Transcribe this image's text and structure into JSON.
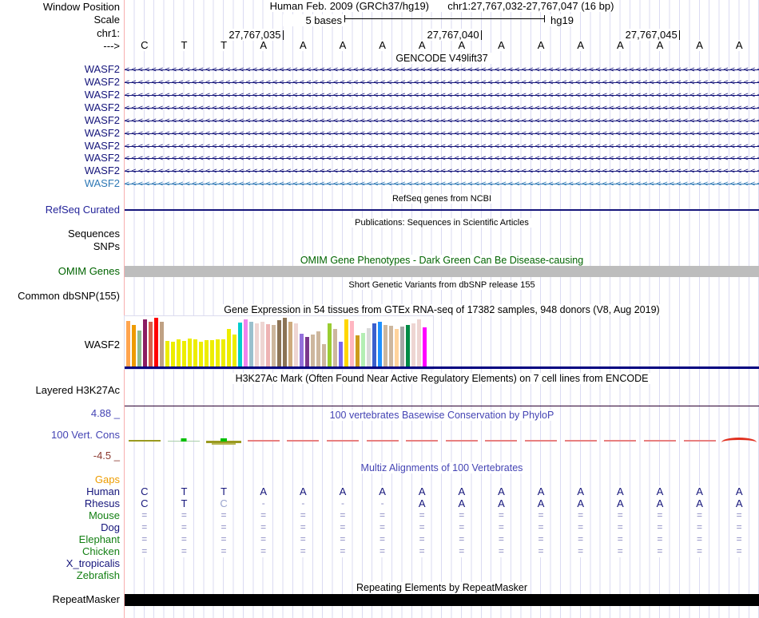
{
  "header": {
    "window_position_label": "Window Position",
    "assembly_title": "Human Feb. 2009 (GRCh37/hg19)",
    "position_title": "chr1:27,767,032-27,767,047 (16 bp)",
    "scale_label": "Scale",
    "scale_value": "5 bases",
    "assembly_tag": "hg19",
    "chrom_label": "chr1:",
    "strand_label": "--->",
    "ruler_positions": [
      "27,767,035",
      "27,767,040",
      "27,767,045"
    ]
  },
  "sequence": {
    "bases": [
      "C",
      "T",
      "T",
      "A",
      "A",
      "A",
      "A",
      "A",
      "A",
      "A",
      "A",
      "A",
      "A",
      "A",
      "A",
      "A"
    ]
  },
  "gencode": {
    "title": "GENCODE V49lift37",
    "genes": [
      {
        "label": "WASF2",
        "color": "#15157B"
      },
      {
        "label": "WASF2",
        "color": "#15157B"
      },
      {
        "label": "WASF2",
        "color": "#15157B"
      },
      {
        "label": "WASF2",
        "color": "#15157B"
      },
      {
        "label": "WASF2",
        "color": "#15157B"
      },
      {
        "label": "WASF2",
        "color": "#15157B"
      },
      {
        "label": "WASF2",
        "color": "#15157B"
      },
      {
        "label": "WASF2",
        "color": "#15157B"
      },
      {
        "label": "WASF2",
        "color": "#15157B"
      },
      {
        "label": "WASF2",
        "color": "#2E78B5"
      }
    ]
  },
  "refseq": {
    "title": "RefSeq genes from NCBI",
    "label": "RefSeq Curated",
    "color": "#24249A"
  },
  "publications": {
    "title": "Publications: Sequences in Scientific Articles",
    "labels": [
      "Sequences",
      "SNPs"
    ]
  },
  "omim": {
    "title": "OMIM Gene Phenotypes - Dark Green Can Be Disease-causing",
    "label": "OMIM Genes",
    "bar_color": "#BDBDBD"
  },
  "dbsnp": {
    "title": "Short Genetic Variants from dbSNP release 155",
    "label": "Common dbSNP(155)"
  },
  "chart_data": {
    "type": "bar",
    "title": "Gene Expression in 54 tissues from GTEx RNA-seq of 17382 samples, 948 donors (V8, Aug 2019)",
    "track_label": "WASF2",
    "ylabel": "relative expression (no axis shown)",
    "baseline_color": "#000080",
    "bars": [
      {
        "color": "#FFA54F",
        "value": 0.93
      },
      {
        "color": "#EE9A00",
        "value": 0.85
      },
      {
        "color": "#8FBC8F",
        "value": 0.74
      },
      {
        "color": "#8B1C62",
        "value": 0.96
      },
      {
        "color": "#D5604C",
        "value": 0.92
      },
      {
        "color": "#FF0000",
        "value": 1.0
      },
      {
        "color": "#BFA183",
        "value": 0.92
      },
      {
        "color": "#EDED00",
        "value": 0.54
      },
      {
        "color": "#EDED00",
        "value": 0.52
      },
      {
        "color": "#EDED00",
        "value": 0.56
      },
      {
        "color": "#EDED00",
        "value": 0.54
      },
      {
        "color": "#EDED00",
        "value": 0.58
      },
      {
        "color": "#EDED00",
        "value": 0.57
      },
      {
        "color": "#EDED00",
        "value": 0.52
      },
      {
        "color": "#EDED00",
        "value": 0.55
      },
      {
        "color": "#EDED00",
        "value": 0.55
      },
      {
        "color": "#EDED00",
        "value": 0.56
      },
      {
        "color": "#EDED00",
        "value": 0.56
      },
      {
        "color": "#EDED00",
        "value": 0.78
      },
      {
        "color": "#EDED00",
        "value": 0.66
      },
      {
        "color": "#00CDCD",
        "value": 0.9
      },
      {
        "color": "#EE82EE",
        "value": 0.96
      },
      {
        "color": "#9AC0CD",
        "value": 0.92
      },
      {
        "color": "#EED5D2",
        "value": 0.89
      },
      {
        "color": "#EED5D2",
        "value": 0.92
      },
      {
        "color": "#EEB4B4",
        "value": 0.87
      },
      {
        "color": "#CDB79E",
        "value": 0.85
      },
      {
        "color": "#8B7355",
        "value": 0.95
      },
      {
        "color": "#8B7355",
        "value": 1.0
      },
      {
        "color": "#CDAA7D",
        "value": 0.92
      },
      {
        "color": "#EED5D2",
        "value": 0.88
      },
      {
        "color": "#9370DB",
        "value": 0.68
      },
      {
        "color": "#7A378B",
        "value": 0.62
      },
      {
        "color": "#CDB79E",
        "value": 0.66
      },
      {
        "color": "#CDB79E",
        "value": 0.72
      },
      {
        "color": "#CDB79E",
        "value": 0.47
      },
      {
        "color": "#9ACD32",
        "value": 0.88
      },
      {
        "color": "#CDB79E",
        "value": 0.77
      },
      {
        "color": "#7A67EE",
        "value": 0.52
      },
      {
        "color": "#FFD700",
        "value": 0.97
      },
      {
        "color": "#FFB6C1",
        "value": 0.93
      },
      {
        "color": "#CD9B1D",
        "value": 0.64
      },
      {
        "color": "#B4EEB4",
        "value": 0.7
      },
      {
        "color": "#D9D9D9",
        "value": 0.79
      },
      {
        "color": "#3A5FCD",
        "value": 0.88
      },
      {
        "color": "#1E90FF",
        "value": 0.92
      },
      {
        "color": "#CDB79E",
        "value": 0.86
      },
      {
        "color": "#CDB79E",
        "value": 0.84
      },
      {
        "color": "#FFD39B",
        "value": 0.77
      },
      {
        "color": "#A6A6A6",
        "value": 0.82
      },
      {
        "color": "#008B45",
        "value": 0.85
      },
      {
        "color": "#EED5D2",
        "value": 0.88
      },
      {
        "color": "#EED5D2",
        "value": 0.97
      },
      {
        "color": "#FF00FF",
        "value": 0.81
      }
    ]
  },
  "h3k27ac": {
    "title": "H3K27Ac Mark (Often Found Near Active Regulatory Elements) on 7 cell lines from ENCODE",
    "label": "Layered H3K27Ac"
  },
  "phylop": {
    "title": "100 vertebrates Basewise Conservation by PhyloP",
    "label": "100 Vert. Cons",
    "max_label": "4.88 _",
    "min_label": "-4.5 _",
    "max_color": "#4444B4",
    "min_color": "#8C3A30",
    "marks": [
      {
        "type": "olive"
      },
      {
        "type": "green-peak"
      },
      {
        "type": "olive-peak"
      },
      {
        "type": "red"
      },
      {
        "type": "red"
      },
      {
        "type": "red"
      },
      {
        "type": "red"
      },
      {
        "type": "red"
      },
      {
        "type": "red"
      },
      {
        "type": "red"
      },
      {
        "type": "red"
      },
      {
        "type": "red"
      },
      {
        "type": "red"
      },
      {
        "type": "red"
      },
      {
        "type": "red"
      },
      {
        "type": "red-caret"
      }
    ]
  },
  "multiz": {
    "title": "Multiz Alignments of 100 Vertebrates",
    "rows": [
      {
        "label": "Gaps",
        "label_color": "#ED9C00",
        "cell_color": "#8C8CC4",
        "cells": []
      },
      {
        "label": "Human",
        "label_color": "#15157B",
        "cell_color": "#15157B",
        "cells": [
          {
            "t": "C"
          },
          {
            "t": "T"
          },
          {
            "t": "T"
          },
          {
            "t": "A"
          },
          {
            "t": "A"
          },
          {
            "t": "A"
          },
          {
            "t": "A"
          },
          {
            "t": "A"
          },
          {
            "t": "A"
          },
          {
            "t": "A"
          },
          {
            "t": "A"
          },
          {
            "t": "A"
          },
          {
            "t": "A"
          },
          {
            "t": "A"
          },
          {
            "t": "A"
          },
          {
            "t": "A"
          }
        ]
      },
      {
        "label": "Rhesus",
        "label_color": "#15157B",
        "cell_color": "#15157B",
        "cells": [
          {
            "t": "C"
          },
          {
            "t": "T"
          },
          {
            "t": "C",
            "c": "#9AA4CE"
          },
          {
            "t": "-",
            "c": "#8C8CC4"
          },
          {
            "t": "-",
            "c": "#8C8CC4"
          },
          {
            "t": "-",
            "c": "#8C8CC4"
          },
          {
            "t": "-",
            "c": "#8C8CC4"
          },
          {
            "t": "A"
          },
          {
            "t": "A"
          },
          {
            "t": "A"
          },
          {
            "t": "A"
          },
          {
            "t": "A"
          },
          {
            "t": "A"
          },
          {
            "t": "A"
          },
          {
            "t": "A"
          },
          {
            "t": "A"
          }
        ]
      },
      {
        "label": "Mouse",
        "label_color": "#148014",
        "cell_color": "#8C8CC4",
        "cells": [
          {
            "t": "="
          },
          {
            "t": "="
          },
          {
            "t": "="
          },
          {
            "t": "="
          },
          {
            "t": "="
          },
          {
            "t": "="
          },
          {
            "t": "="
          },
          {
            "t": "="
          },
          {
            "t": "="
          },
          {
            "t": "="
          },
          {
            "t": "="
          },
          {
            "t": "="
          },
          {
            "t": "="
          },
          {
            "t": "="
          },
          {
            "t": "="
          },
          {
            "t": "="
          }
        ]
      },
      {
        "label": "Dog",
        "label_color": "#15157B",
        "cell_color": "#8C8CC4",
        "cells": [
          {
            "t": "="
          },
          {
            "t": "="
          },
          {
            "t": "="
          },
          {
            "t": "="
          },
          {
            "t": "="
          },
          {
            "t": "="
          },
          {
            "t": "="
          },
          {
            "t": "="
          },
          {
            "t": "="
          },
          {
            "t": "="
          },
          {
            "t": "="
          },
          {
            "t": "="
          },
          {
            "t": "="
          },
          {
            "t": "="
          },
          {
            "t": "="
          },
          {
            "t": "="
          }
        ]
      },
      {
        "label": "Elephant",
        "label_color": "#148014",
        "cell_color": "#8C8CC4",
        "cells": [
          {
            "t": "="
          },
          {
            "t": "="
          },
          {
            "t": "="
          },
          {
            "t": "="
          },
          {
            "t": "="
          },
          {
            "t": "="
          },
          {
            "t": "="
          },
          {
            "t": "="
          },
          {
            "t": "="
          },
          {
            "t": "="
          },
          {
            "t": "="
          },
          {
            "t": "="
          },
          {
            "t": "="
          },
          {
            "t": "="
          },
          {
            "t": "="
          },
          {
            "t": "="
          }
        ]
      },
      {
        "label": "Chicken",
        "label_color": "#148014",
        "cell_color": "#8C8CC4",
        "cells": [
          {
            "t": "="
          },
          {
            "t": "="
          },
          {
            "t": "="
          },
          {
            "t": "="
          },
          {
            "t": "="
          },
          {
            "t": "="
          },
          {
            "t": "="
          },
          {
            "t": "="
          },
          {
            "t": "="
          },
          {
            "t": "="
          },
          {
            "t": "="
          },
          {
            "t": "="
          },
          {
            "t": "="
          },
          {
            "t": "="
          },
          {
            "t": "="
          },
          {
            "t": "="
          }
        ]
      },
      {
        "label": "X_tropicalis",
        "label_color": "#15157B",
        "cell_color": "#8C8CC4",
        "cells": []
      },
      {
        "label": "Zebrafish",
        "label_color": "#148014",
        "cell_color": "#8C8CC4",
        "cells": []
      }
    ]
  },
  "repeatmasker": {
    "title": "Repeating Elements by RepeatMasker",
    "label": "RepeatMasker",
    "bar_color": "#000000"
  }
}
